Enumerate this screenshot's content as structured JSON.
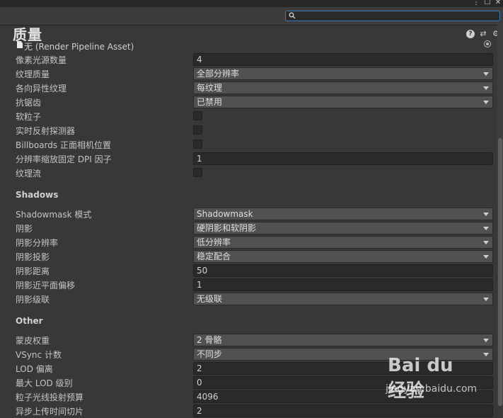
{
  "window": {
    "menu_glyph": "⋮",
    "maximize_glyph": "☐",
    "close_glyph": "✕"
  },
  "search": {
    "value": ""
  },
  "header": {
    "title": "质量",
    "icons": [
      "help-icon",
      "preset-icon",
      "gear-icon"
    ],
    "help_glyph": "?",
    "preset_glyph": "⇄",
    "gear_glyph": "⚙"
  },
  "asset_field": {
    "text": "无 (Render Pipeline Asset)"
  },
  "rendering": [
    {
      "label": "像素光源数量",
      "type": "text",
      "value": "4"
    },
    {
      "label": "纹理质量",
      "type": "dropdown",
      "value": "全部分辨率"
    },
    {
      "label": "各向异性纹理",
      "type": "dropdown",
      "value": "每纹理"
    },
    {
      "label": "抗锯齿",
      "type": "dropdown",
      "value": "已禁用"
    },
    {
      "label": "软粒子",
      "type": "checkbox",
      "checked": false
    },
    {
      "label": "实时反射探测器",
      "type": "checkbox",
      "checked": false
    },
    {
      "label": "Billboards 正面相机位置",
      "type": "checkbox",
      "checked": false
    },
    {
      "label": "分辨率缩放固定 DPI 因子",
      "type": "text",
      "value": "1"
    },
    {
      "label": "纹理流",
      "type": "checkbox",
      "checked": false
    }
  ],
  "shadows": {
    "title": "Shadows",
    "rows": [
      {
        "label": "Shadowmask 模式",
        "type": "dropdown",
        "value": "Shadowmask"
      },
      {
        "label": "阴影",
        "type": "dropdown",
        "value": "硬阴影和软阴影"
      },
      {
        "label": "阴影分辨率",
        "type": "dropdown",
        "value": "低分辨率"
      },
      {
        "label": "阴影投影",
        "type": "dropdown",
        "value": "稳定配合"
      },
      {
        "label": "阴影距离",
        "type": "text",
        "value": "50"
      },
      {
        "label": "阴影近平面偏移",
        "type": "text",
        "value": "1"
      },
      {
        "label": "阴影级联",
        "type": "dropdown",
        "value": "无级联"
      }
    ]
  },
  "other": {
    "title": "Other",
    "rows": [
      {
        "label": "蒙皮权重",
        "type": "dropdown",
        "value": "2 骨骼"
      },
      {
        "label": "VSync 计数",
        "type": "dropdown",
        "value": "不同步"
      },
      {
        "label": "LOD 偏离",
        "type": "text",
        "value": "2"
      },
      {
        "label": "最大 LOD 级别",
        "type": "text",
        "value": "0"
      },
      {
        "label": "粒子光线投射预算",
        "type": "text",
        "value": "4096"
      },
      {
        "label": "异步上传时间切片",
        "type": "text",
        "value": "2"
      }
    ]
  },
  "watermark": {
    "logo": "Bai du 经验",
    "url": "jingyan.baidu.com"
  }
}
